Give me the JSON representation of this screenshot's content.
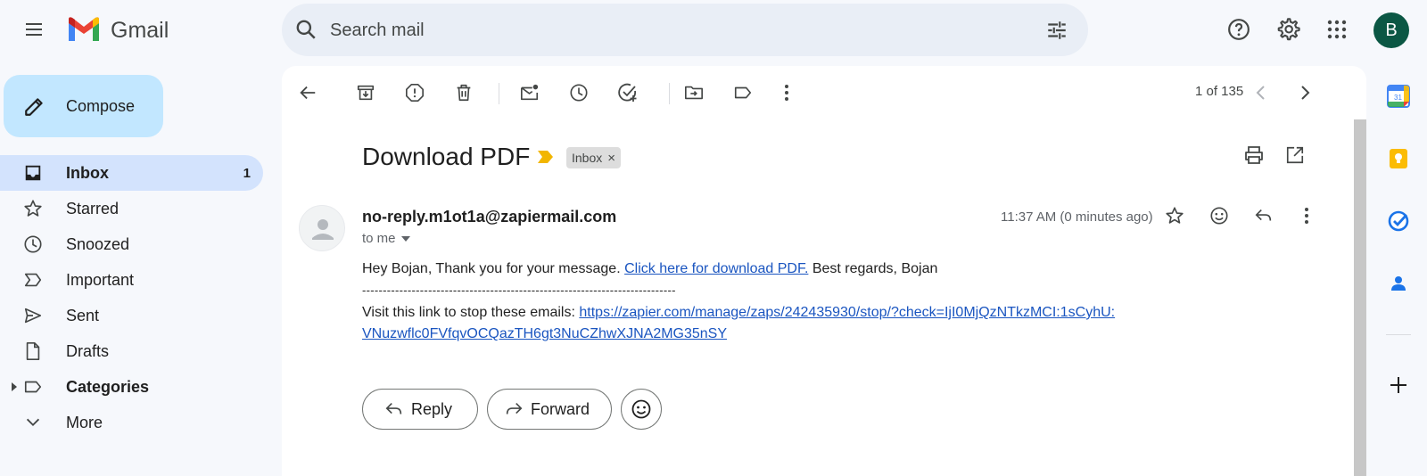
{
  "app": {
    "name": "Gmail"
  },
  "search": {
    "placeholder": "Search mail"
  },
  "account": {
    "initial": "B"
  },
  "compose": {
    "label": "Compose"
  },
  "nav": {
    "inbox": {
      "label": "Inbox",
      "count": "1"
    },
    "starred": {
      "label": "Starred"
    },
    "snoozed": {
      "label": "Snoozed"
    },
    "important": {
      "label": "Important"
    },
    "sent": {
      "label": "Sent"
    },
    "drafts": {
      "label": "Drafts"
    },
    "categories": {
      "label": "Categories"
    },
    "more": {
      "label": "More"
    }
  },
  "toolbar": {
    "pager": "1 of 135"
  },
  "email": {
    "subject": "Download PDF",
    "label": "Inbox",
    "label_remove": "×",
    "sender": "no-reply.m1ot1a@zapiermail.com",
    "recipient": "to me",
    "time": "11:37 AM (0 minutes ago)",
    "greeting": "Hey Bojan, Thank you for your message. ",
    "download_link": "Click here for download PDF.",
    "closing": " Best regards, Bojan",
    "separator": "----------------------------------------------------------------------------",
    "unsubscribe_text": "Visit this link to stop these emails: ",
    "unsubscribe_link_1": "https://zapier.com/manage/zaps/242435930/stop/?check=IjI0MjQzNTkzMCI:1sCyhU:",
    "unsubscribe_link_2": "VNuzwflc0FVfqvOCQazTH6gt3NuCZhwXJNA2MG35nSY"
  },
  "actions": {
    "reply": "Reply",
    "forward": "Forward"
  },
  "colors": {
    "accent": "#0b57d0",
    "compose_bg": "#c2e7ff",
    "active_nav": "#d3e3fd",
    "avatar": "#0b5744",
    "link": "#1a55c0"
  },
  "icons": [
    "menu-icon",
    "gmail-logo",
    "search-icon",
    "filter-options-icon",
    "help-icon",
    "settings-icon",
    "apps-grid-icon",
    "pencil-icon",
    "inbox-icon",
    "star-icon",
    "clock-icon",
    "important-icon",
    "send-icon",
    "draft-icon",
    "label-icon",
    "chevron-down-icon",
    "back-arrow-icon",
    "archive-icon",
    "report-spam-icon",
    "delete-icon",
    "mark-unread-icon",
    "snooze-icon",
    "add-task-icon",
    "move-to-icon",
    "labels-icon",
    "more-vert-icon",
    "chevron-left-icon",
    "chevron-right-icon",
    "print-icon",
    "open-new-window-icon",
    "emoji-icon",
    "reply-icon",
    "forward-icon",
    "calendar-icon",
    "keep-icon",
    "tasks-icon",
    "contacts-icon",
    "plus-icon"
  ]
}
